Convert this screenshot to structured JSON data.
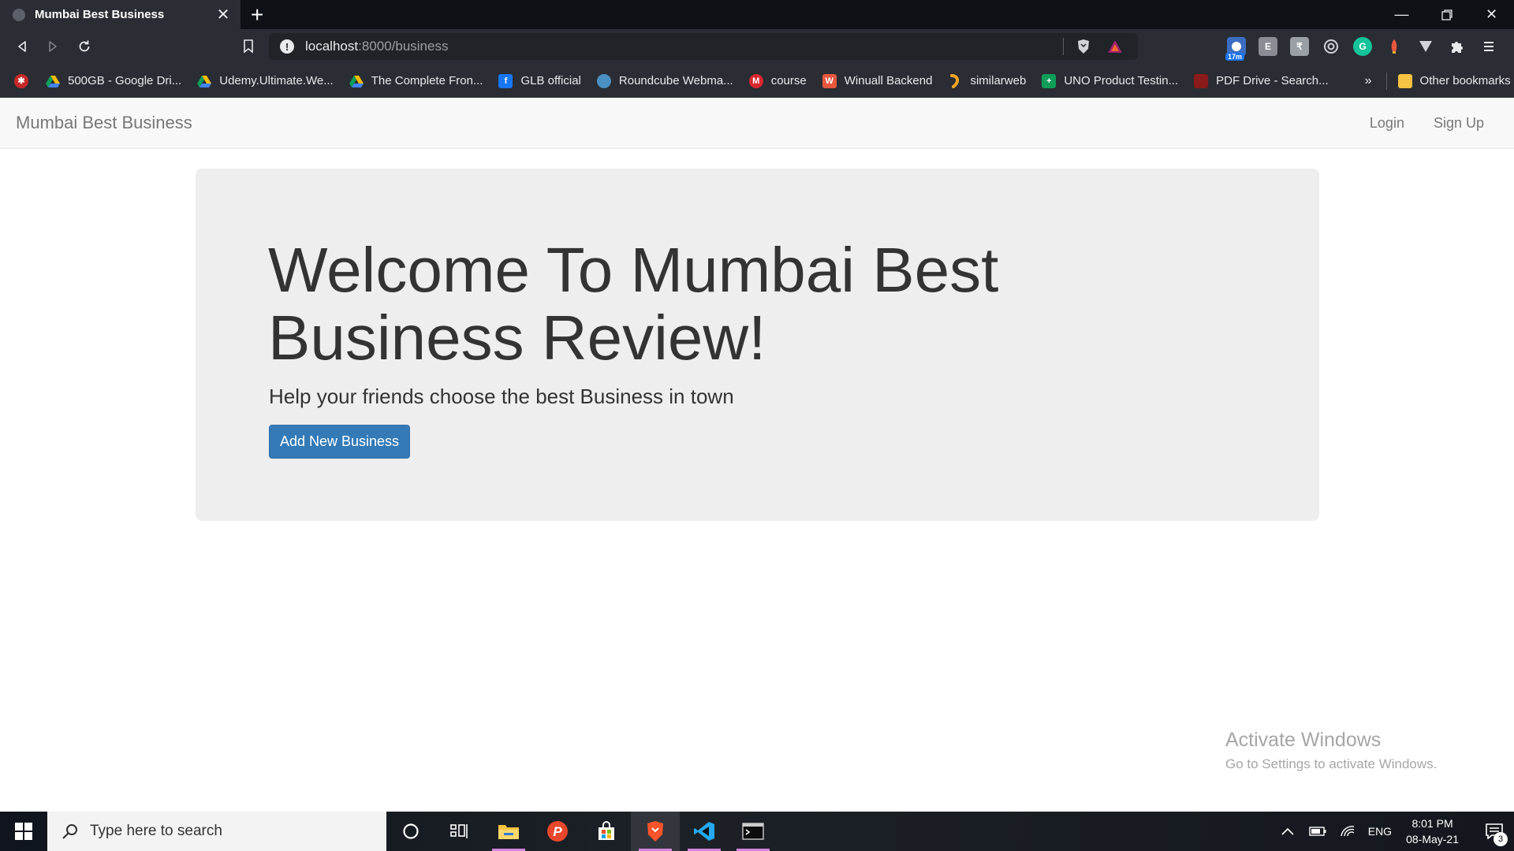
{
  "browser": {
    "tab_title": "Mumbai Best Business",
    "url_host": "localhost",
    "url_rest": ":8000/business",
    "bookmarks": [
      {
        "label": "500GB - Google Dri...",
        "icon": "google-drive-icon"
      },
      {
        "label": "Udemy.Ultimate.We...",
        "icon": "google-drive-icon"
      },
      {
        "label": "The Complete Fron...",
        "icon": "google-drive-icon"
      },
      {
        "label": "GLB official",
        "icon": "facebook-icon"
      },
      {
        "label": "Roundcube Webma...",
        "icon": "roundcube-icon"
      },
      {
        "label": "course",
        "icon": "mega-icon"
      },
      {
        "label": "Winuall Backend",
        "icon": "winuall-icon"
      },
      {
        "label": "similarweb",
        "icon": "similarweb-icon"
      },
      {
        "label": "UNO Product Testin...",
        "icon": "sheets-icon"
      },
      {
        "label": "PDF Drive - Search...",
        "icon": "pdf-drive-icon"
      }
    ],
    "other_bookmarks": "Other bookmarks",
    "more": "»",
    "extension_badge": "17m"
  },
  "navbar": {
    "brand": "Mumbai Best Business",
    "login": "Login",
    "signup": "Sign Up"
  },
  "jumbotron": {
    "title": "Welcome To Mumbai Best Business Review!",
    "lead": "Help your friends choose the best Business in town",
    "button": "Add New Business"
  },
  "watermark": {
    "title": "Activate Windows",
    "subtitle": "Go to Settings to activate Windows."
  },
  "taskbar": {
    "search_placeholder": "Type here to search",
    "language": "ENG",
    "time": "8:01 PM",
    "date": "08-May-21",
    "notifications": "3"
  }
}
